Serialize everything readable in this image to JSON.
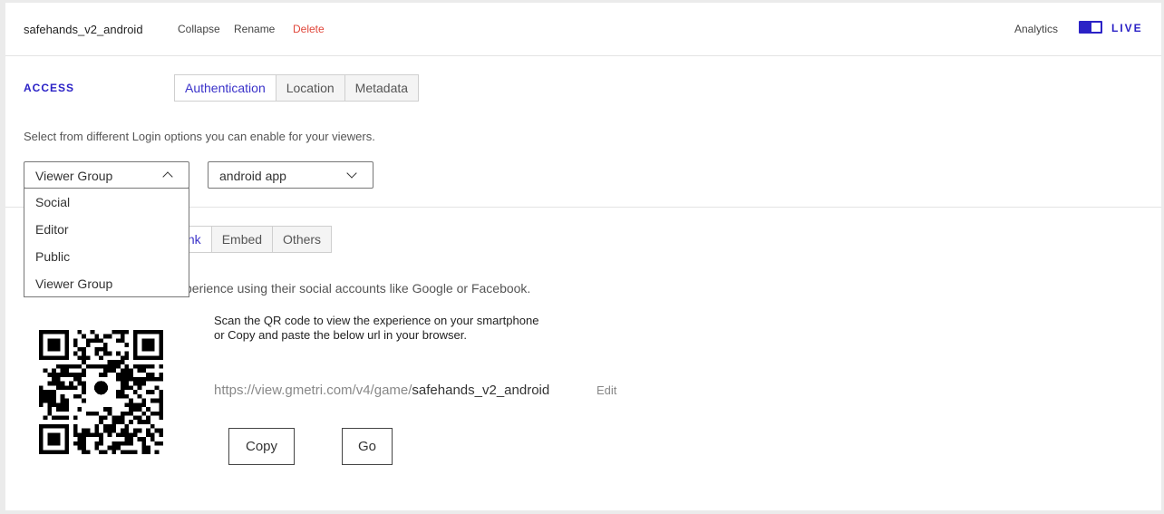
{
  "header": {
    "title": "safehands_v2_android",
    "collapse_label": "Collapse",
    "rename_label": "Rename",
    "delete_label": "Delete",
    "analytics_label": "Analytics",
    "live_label": "LIVE",
    "live_toggle_on": true
  },
  "access": {
    "section_label": "ACCESS",
    "tabs": [
      {
        "label": "Authentication",
        "active": true
      },
      {
        "label": "Location",
        "active": false
      },
      {
        "label": "Metadata",
        "active": false
      }
    ],
    "description": "Select from different Login options you can enable for your viewers.",
    "login_select": {
      "selected": "Viewer Group",
      "options": [
        "Social",
        "Editor",
        "Public",
        "Viewer Group"
      ]
    },
    "group_select": {
      "selected": "android app"
    }
  },
  "share": {
    "tabs": [
      {
        "label": "Link",
        "active": true
      },
      {
        "label": "Embed",
        "active": false
      },
      {
        "label": "Others",
        "active": false
      }
    ],
    "description_visible": "perience using their social accounts like Google or Facebook.",
    "scan_line1": "Scan the QR code to view the experience on your smartphone",
    "scan_line2": "or Copy and paste the below url in your browser.",
    "url_prefix": "https://view.gmetri.com/v4/game/",
    "url_slug": "safehands_v2_android",
    "edit_label": "Edit",
    "copy_label": "Copy",
    "go_label": "Go"
  },
  "colors": {
    "accent": "#2b22c6",
    "danger": "#e0463a"
  }
}
